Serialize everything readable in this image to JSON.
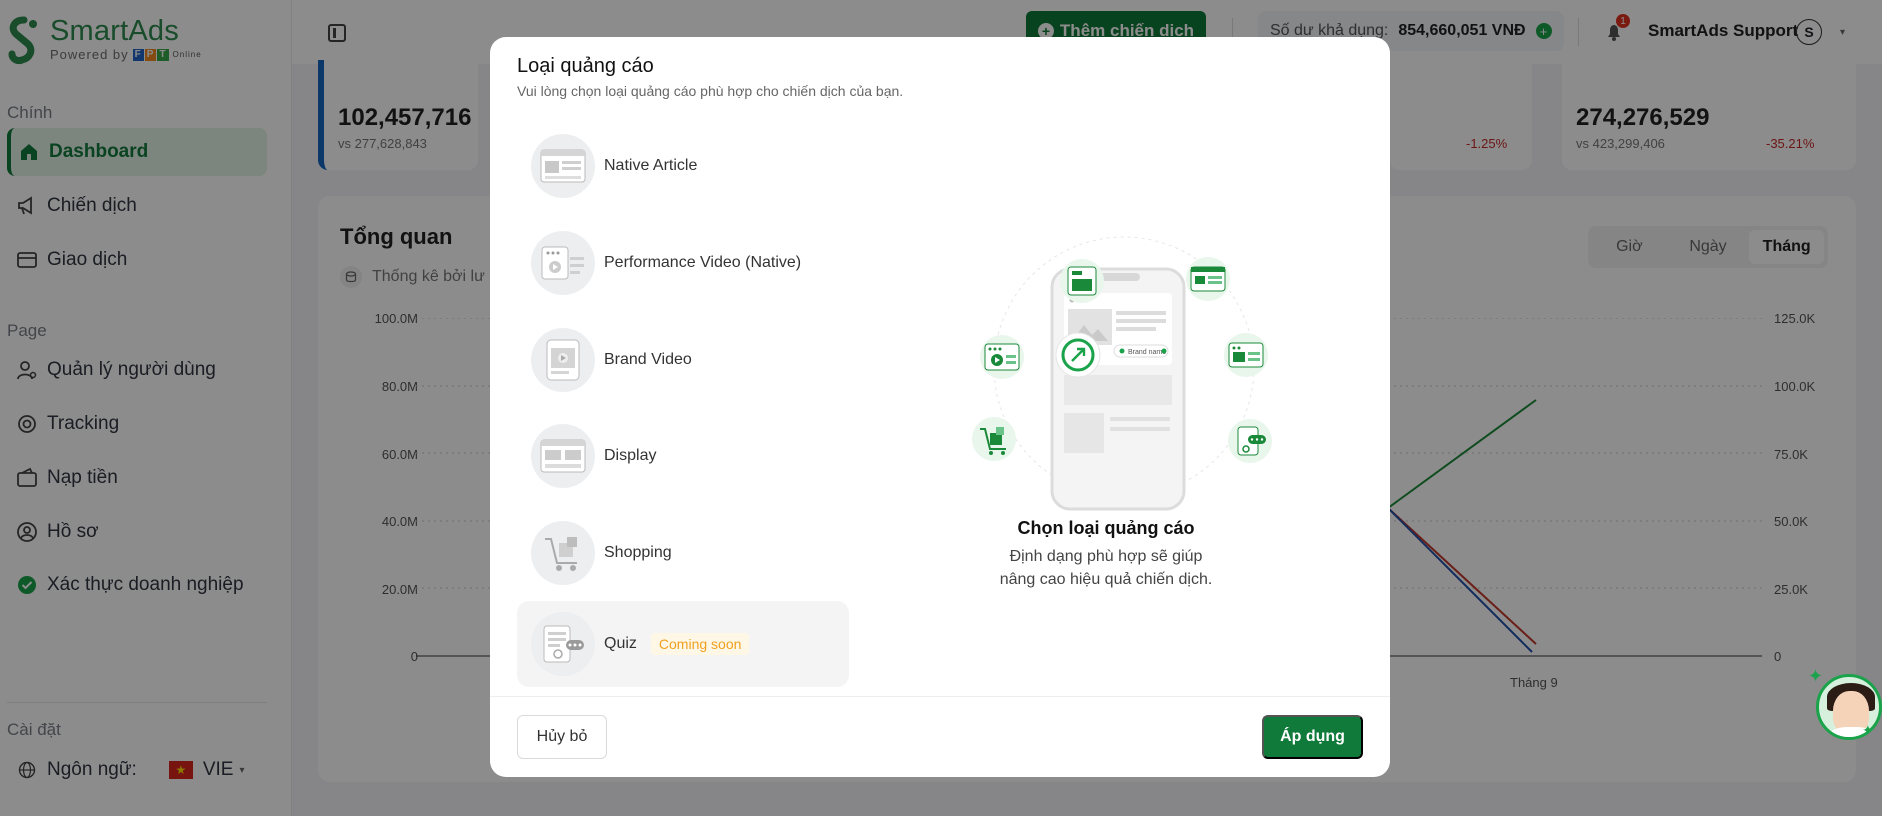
{
  "brand": {
    "name": "SmartAds",
    "powered_by": "Powered by",
    "fpt_f": "F",
    "fpt_p": "P",
    "fpt_t": "T",
    "fpt_online": "Online",
    "accent": "#0f7a3a"
  },
  "sidebar": {
    "section_main": "Chính",
    "section_page": "Page",
    "section_settings": "Cài đặt",
    "items": [
      {
        "label": "Dashboard",
        "icon": "home-icon",
        "active": true
      },
      {
        "label": "Chiến dịch",
        "icon": "megaphone-icon"
      },
      {
        "label": "Giao dịch",
        "icon": "wallet-icon"
      },
      {
        "label": "Quản lý người dùng",
        "icon": "user-gear-icon"
      },
      {
        "label": "Tracking",
        "icon": "target-icon"
      },
      {
        "label": "Nạp tiền",
        "icon": "deposit-icon"
      },
      {
        "label": "Hồ sơ",
        "icon": "profile-icon"
      },
      {
        "label": "Xác thực doanh nghiệp",
        "icon": "verified-check-icon"
      }
    ],
    "language_label": "Ngôn ngữ:",
    "language_code": "VIE"
  },
  "header": {
    "add_campaign": "Thêm chiến dịch",
    "balance_label": "Số dư khả dụng:",
    "balance_value": "854,660,051 VNĐ",
    "notification_count": "1",
    "user_name": "SmartAds Support",
    "user_initial": "S"
  },
  "stats": {
    "card1_value": "102,457,716",
    "card1_vs": "vs 277,628,843",
    "card2_delta": "-1.25%",
    "card3_value": "274,276,529",
    "card3_vs": "vs 423,299,406",
    "card3_delta": "-35.21%"
  },
  "overview": {
    "title": "Tổng quan",
    "subtitle": "Thống kê bởi lư",
    "range_tabs": [
      "Giờ",
      "Ngày",
      "Tháng"
    ],
    "active_range": "Tháng"
  },
  "chart_data": {
    "type": "line",
    "y_left_ticks": [
      "100.0M",
      "80.0M",
      "60.0M",
      "40.0M",
      "20.0M",
      "0"
    ],
    "y_right_ticks": [
      "125.0K",
      "100.0K",
      "75.0K",
      "50.0K",
      "25.0K",
      "0"
    ],
    "x_visible_ticks": [
      "Tháng 9"
    ],
    "series_colors": [
      "#1a8a3a",
      "#c0392b",
      "#1f4fa8"
    ]
  },
  "modal": {
    "title": "Loại quảng cáo",
    "subtitle": "Vui lòng chọn loại quảng cáo phù hợp cho chiến dịch của bạn.",
    "options": [
      {
        "label": "Native Article",
        "icon": "native-article-icon"
      },
      {
        "label": "Performance Video (Native)",
        "icon": "performance-video-icon"
      },
      {
        "label": "Brand Video",
        "icon": "brand-video-icon"
      },
      {
        "label": "Display",
        "icon": "display-ad-icon"
      },
      {
        "label": "Shopping",
        "icon": "shopping-cart-icon"
      },
      {
        "label": "Quiz",
        "icon": "quiz-icon",
        "badge": "Coming soon"
      }
    ],
    "illustration_brand": "Brand name",
    "illustration_title": "Chọn loại quảng cáo",
    "illustration_desc_line1": "Định dạng phù hợp sẽ giúp",
    "illustration_desc_line2": "nâng cao hiệu quả chiến dịch.",
    "cancel": "Hủy bỏ",
    "apply": "Áp dụng"
  }
}
